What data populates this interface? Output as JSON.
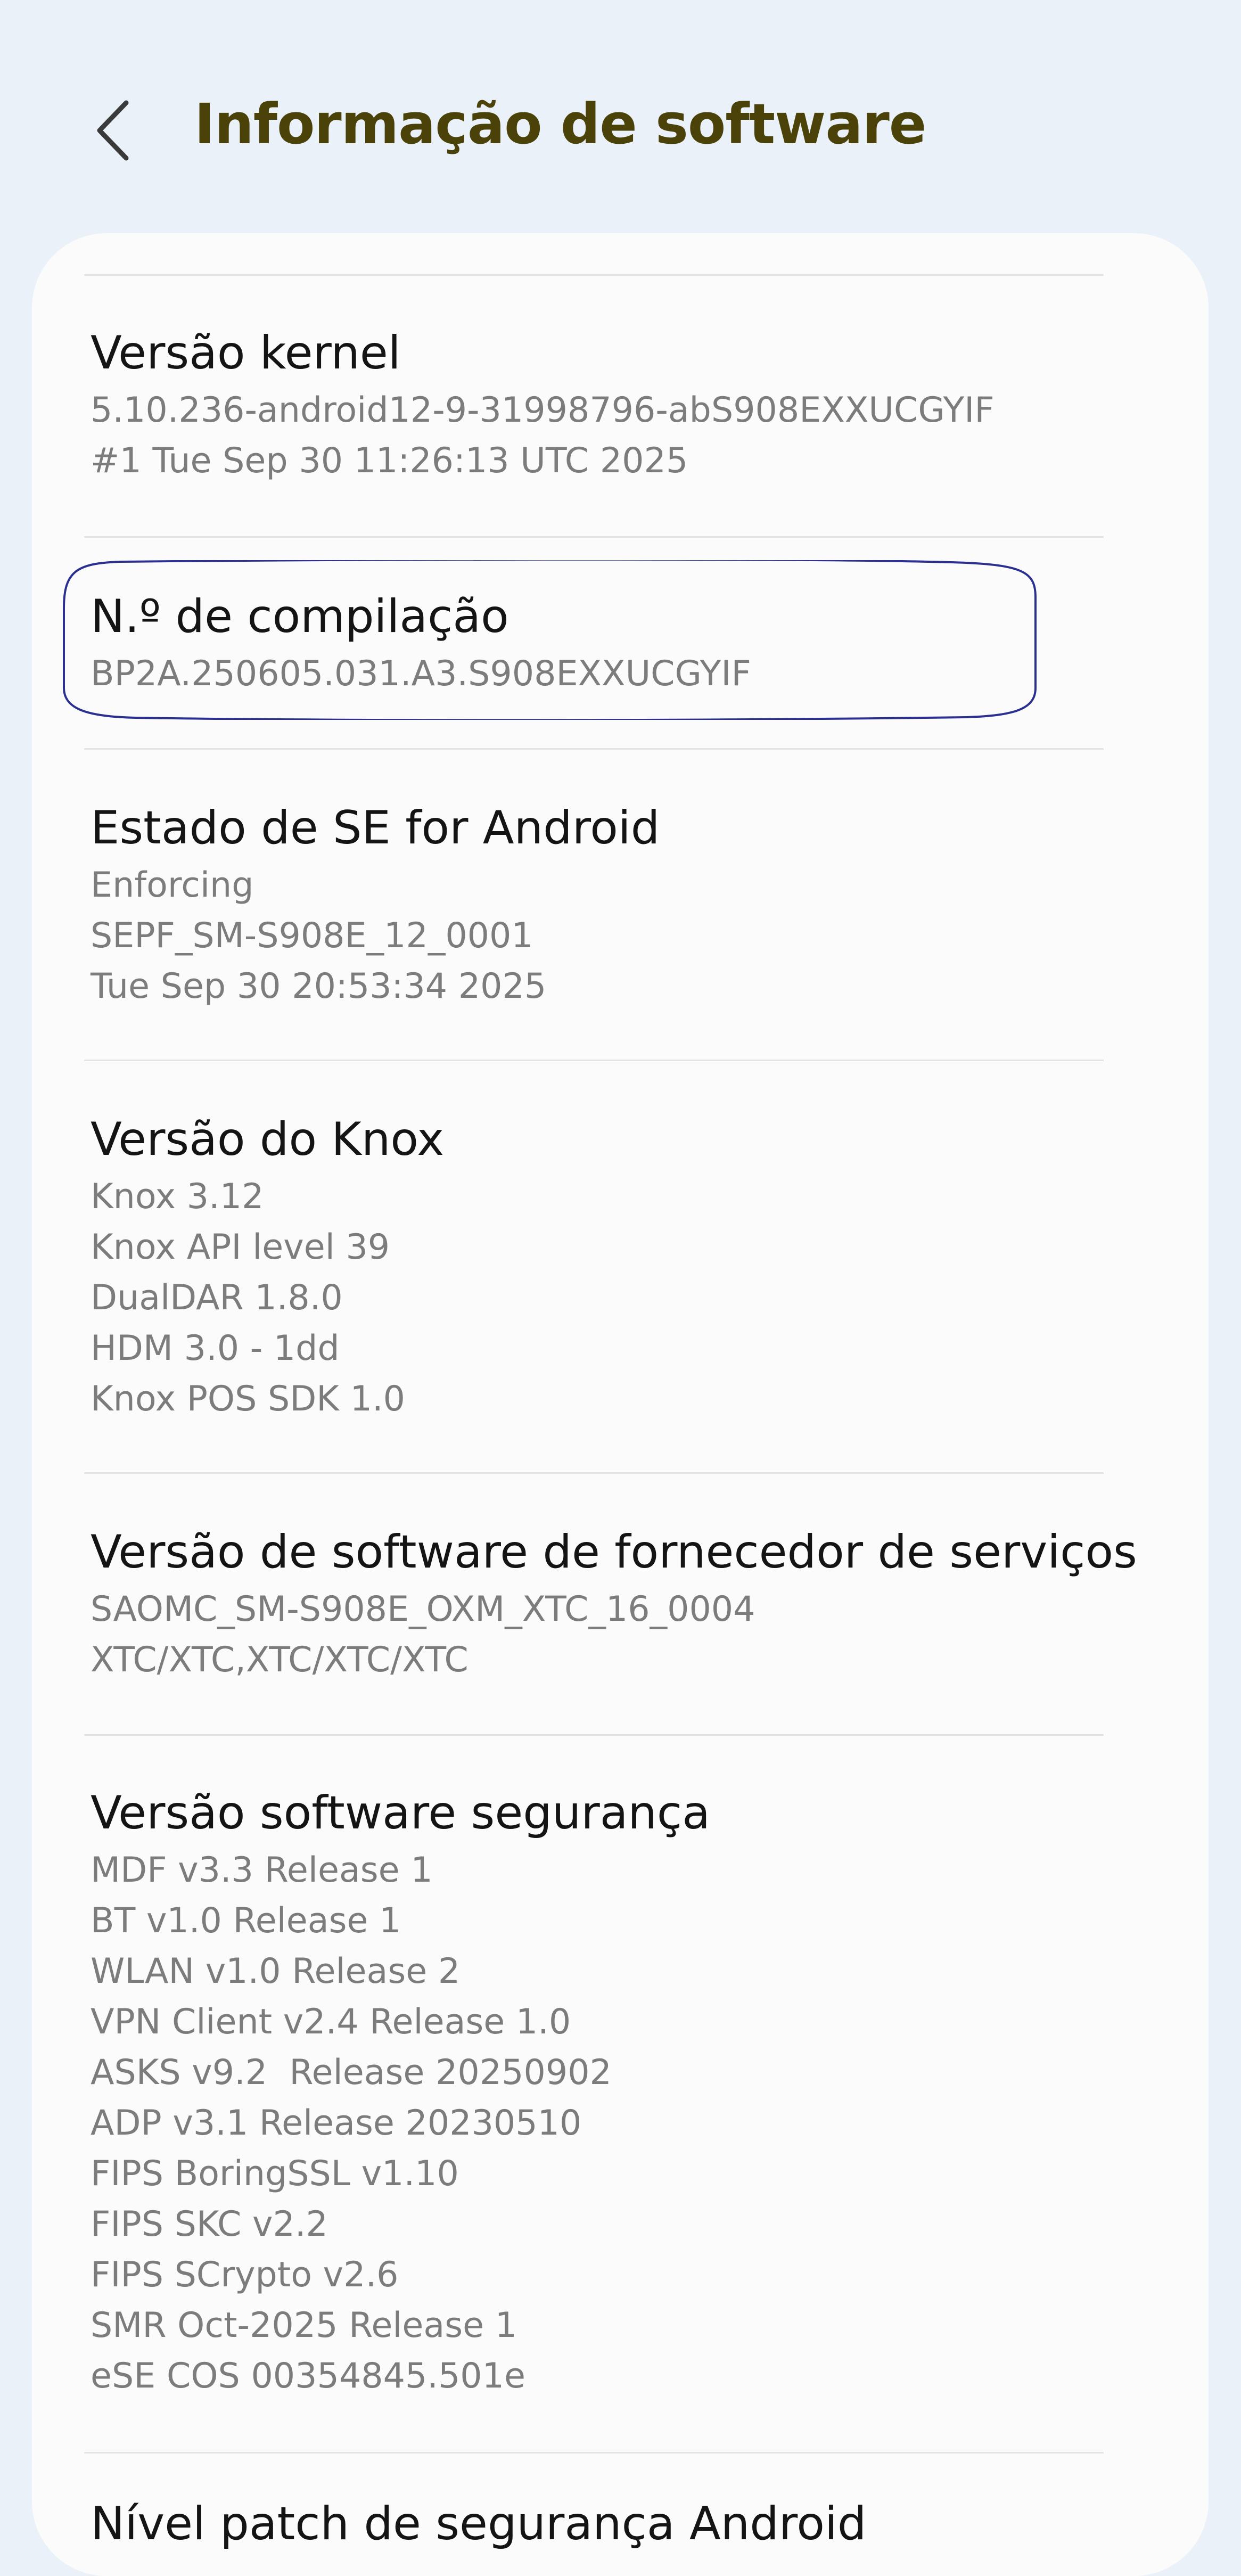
{
  "header": {
    "title": "Informação de software",
    "back_icon": "chevron-left-icon"
  },
  "colors": {
    "background": "#eaf1f9",
    "card": "#fbfbfb",
    "title": "#4a4208",
    "item_title": "#141414",
    "item_value": "#7c7c7c",
    "highlight_oval": "#2b2f8f"
  },
  "items": [
    {
      "title": "Versão kernel",
      "lines": [
        "5.10.236-android12-9-31998796-abS908EXXUCGYIF",
        "#1 Tue Sep 30 11:26:13 UTC 2025"
      ]
    },
    {
      "title": "N.º de compilação",
      "lines": [
        "BP2A.250605.031.A3.S908EXXUCGYIF"
      ],
      "highlighted": true
    },
    {
      "title": "Estado de SE for Android",
      "lines": [
        "Enforcing",
        "SEPF_SM-S908E_12_0001",
        "Tue Sep 30 20:53:34 2025"
      ]
    },
    {
      "title": "Versão do Knox",
      "lines": [
        "Knox 3.12",
        "Knox API level 39",
        "DualDAR 1.8.0",
        "HDM 3.0 - 1dd",
        "Knox POS SDK 1.0"
      ]
    },
    {
      "title": "Versão de software de fornecedor de serviços",
      "lines": [
        "SAOMC_SM-S908E_OXM_XTC_16_0004",
        "XTC/XTC,XTC/XTC/XTC"
      ]
    },
    {
      "title": "Versão software segurança",
      "lines": [
        "MDF v3.3 Release 1",
        "BT v1.0 Release 1",
        "WLAN v1.0 Release 2",
        "VPN Client v2.4 Release 1.0",
        "ASKS v9.2  Release 20250902",
        "ADP v3.1 Release 20230510",
        "FIPS BoringSSL v1.10",
        "FIPS SKC v2.2",
        "FIPS SCrypto v2.6",
        "SMR Oct-2025 Release 1",
        "eSE COS 00354845.501e"
      ]
    },
    {
      "title": "Nível patch de segurança Android",
      "lines": []
    }
  ]
}
